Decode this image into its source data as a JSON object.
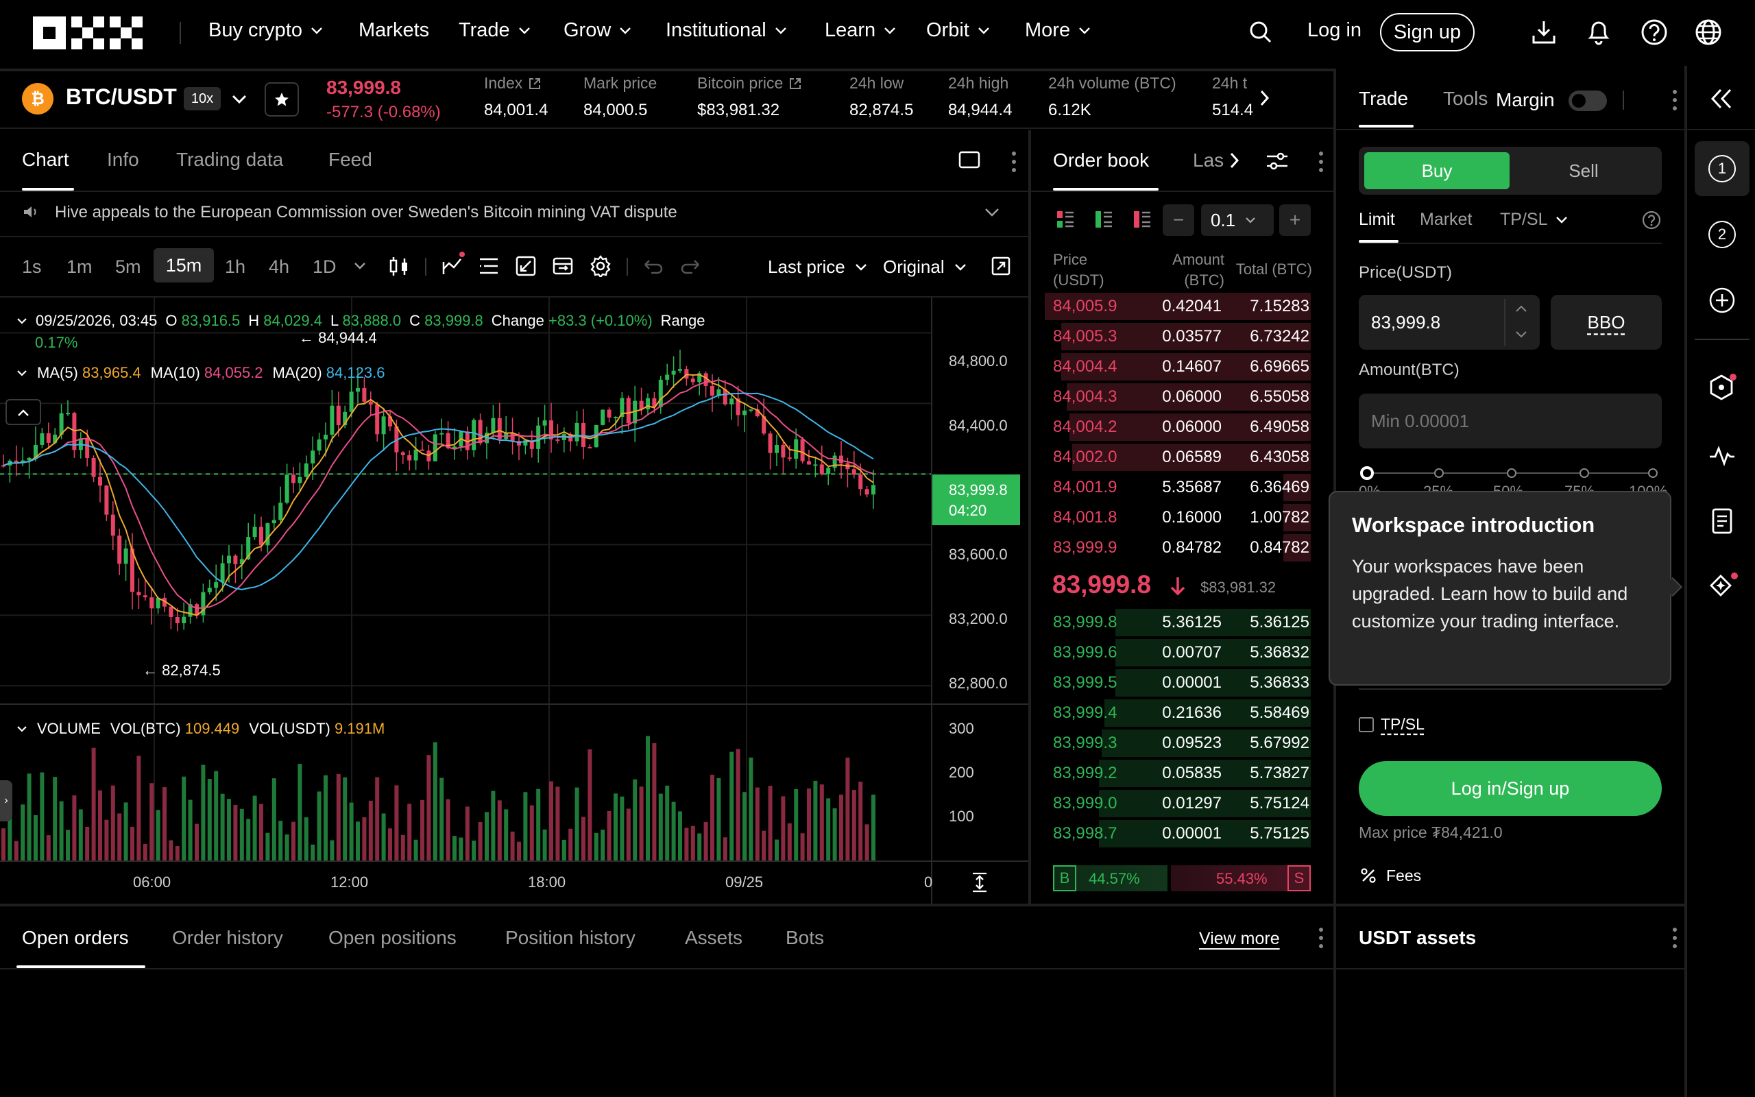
{
  "nav": {
    "logo": "OKX",
    "items": [
      "Buy crypto",
      "Markets",
      "Trade",
      "Grow",
      "Institutional",
      "Learn",
      "Orbit",
      "More"
    ],
    "login": "Log in",
    "signup": "Sign up"
  },
  "ticker": {
    "pair": "BTC/USDT",
    "leverage": "10x",
    "last_price": "83,999.8",
    "change": "-577.3 (-0.68%)",
    "stats": [
      {
        "label": "Index",
        "value": "84,001.4"
      },
      {
        "label": "Mark price",
        "value": "84,000.5"
      },
      {
        "label": "Bitcoin price",
        "value": "$83,981.32"
      },
      {
        "label": "24h low",
        "value": "82,874.5"
      },
      {
        "label": "24h high",
        "value": "84,944.4"
      },
      {
        "label": "24h volume (BTC)",
        "value": "6.12K"
      },
      {
        "label": "24h t",
        "value": "514.4"
      }
    ]
  },
  "chart_tabs": [
    "Chart",
    "Info",
    "Trading data",
    "Feed"
  ],
  "news": "Hive appeals to the European Commission over Sweden's Bitcoin mining VAT dispute",
  "intervals": [
    "1s",
    "1m",
    "5m",
    "15m",
    "1h",
    "4h",
    "1D"
  ],
  "price_type": "Last price",
  "view_mode": "Original",
  "ohlc": {
    "date": "09/25/2026, 03:45",
    "o_label": "O",
    "o": "83,916.5",
    "h_label": "H",
    "h": "84,029.4",
    "l_label": "L",
    "l": "83,888.0",
    "c_label": "C",
    "c": "83,999.8",
    "change_label": "Change",
    "change": "+83.3 (+0.10%)",
    "range_label": "Range",
    "range": "0.17%"
  },
  "ma": {
    "ma5_label": "MA(5)",
    "ma5": "83,965.4",
    "ma10_label": "MA(10)",
    "ma10": "84,055.2",
    "ma20_label": "MA(20)",
    "ma20": "84,123.6"
  },
  "chart_data": {
    "type": "candlestick",
    "price_axis": [
      "84,800.0",
      "84,400.0",
      "84,000.0",
      "83,600.0",
      "83,200.0",
      "82,800.0"
    ],
    "ylim": [
      82700,
      85000
    ],
    "time_axis": [
      "06:00",
      "12:00",
      "18:00",
      "09/25",
      "0"
    ],
    "current_price": "83,999.8",
    "countdown": "04:20",
    "high_marker": "← 84,944.4",
    "low_marker": "← 82,874.5",
    "volume_axis": [
      "300",
      "200",
      "100"
    ],
    "colors": {
      "up": "#2eb855",
      "down": "#e84364",
      "ma5": "#f0a92c",
      "ma10": "#e84f8a",
      "ma20": "#3fb6ea"
    }
  },
  "volume": {
    "label": "VOLUME",
    "btc_label": "VOL(BTC)",
    "btc": "109.449",
    "usdt_label": "VOL(USDT)",
    "usdt": "9.191M"
  },
  "orderbook": {
    "title": "Order book",
    "tab2": "Las",
    "precision": "0.1",
    "headers": {
      "price": "Price (USDT)",
      "amount": "Amount (BTC)",
      "total": "Total (BTC)"
    },
    "asks": [
      {
        "price": "84,005.9",
        "amount": "0.42041",
        "total": "7.15283",
        "depth": 0.98
      },
      {
        "price": "84,005.3",
        "amount": "0.03577",
        "total": "6.73242",
        "depth": 0.92
      },
      {
        "price": "84,004.4",
        "amount": "0.14607",
        "total": "6.69665",
        "depth": 0.92
      },
      {
        "price": "84,004.3",
        "amount": "0.06000",
        "total": "6.55058",
        "depth": 0.9
      },
      {
        "price": "84,004.2",
        "amount": "0.06000",
        "total": "6.49058",
        "depth": 0.89
      },
      {
        "price": "84,002.0",
        "amount": "0.06589",
        "total": "6.43058",
        "depth": 0.88
      },
      {
        "price": "84,001.9",
        "amount": "5.35687",
        "total": "6.36469",
        "depth": 0.1
      },
      {
        "price": "84,001.8",
        "amount": "0.16000",
        "total": "1.00782",
        "depth": 0.1
      },
      {
        "price": "83,999.9",
        "amount": "0.84782",
        "total": "0.84782",
        "depth": 0.1
      }
    ],
    "mid_price": "83,999.8",
    "mid_usd": "$83,981.32",
    "bids": [
      {
        "price": "83,999.8",
        "amount": "5.36125",
        "total": "5.36125",
        "depth": 0.72
      },
      {
        "price": "83,999.6",
        "amount": "0.00707",
        "total": "5.36832",
        "depth": 0.72
      },
      {
        "price": "83,999.5",
        "amount": "0.00001",
        "total": "5.36833",
        "depth": 0.72
      },
      {
        "price": "83,999.4",
        "amount": "0.21636",
        "total": "5.58469",
        "depth": 0.76
      },
      {
        "price": "83,999.3",
        "amount": "0.09523",
        "total": "5.67992",
        "depth": 0.77
      },
      {
        "price": "83,999.2",
        "amount": "0.05835",
        "total": "5.73827",
        "depth": 0.78
      },
      {
        "price": "83,999.0",
        "amount": "0.01297",
        "total": "5.75124",
        "depth": 0.78
      },
      {
        "price": "83,998.7",
        "amount": "0.00001",
        "total": "5.75125",
        "depth": 0.78
      }
    ],
    "buy_label": "B",
    "buy_pct": "44.57%",
    "sell_pct": "55.43%",
    "sell_label": "S"
  },
  "trade": {
    "tabs": [
      "Trade",
      "Tools"
    ],
    "margin_label": "Margin",
    "buy": "Buy",
    "sell": "Sell",
    "order_types": [
      "Limit",
      "Market",
      "TP/SL"
    ],
    "price_label": "Price(USDT)",
    "price_value": "83,999.8",
    "bbo": "BBO",
    "amount_label": "Amount(BTC)",
    "amount_placeholder": "Min 0.00001",
    "slider_marks": [
      "0%",
      "25%",
      "50%",
      "75%",
      "100%"
    ],
    "tpsl": "TP/SL",
    "cta": "Log in/Sign up",
    "max_price": "Max price ₮84,421.0",
    "fees": "Fees"
  },
  "popover": {
    "title": "Workspace introduction",
    "body": "Your workspaces have been upgraded. Learn how to build and customize your trading interface."
  },
  "bottom": {
    "tabs": [
      "Open orders",
      "Order history",
      "Open positions",
      "Position history",
      "Assets",
      "Bots"
    ],
    "view_more": "View more",
    "assets_title": "USDT assets"
  },
  "rail": {
    "ws1": "1",
    "ws2": "2"
  }
}
